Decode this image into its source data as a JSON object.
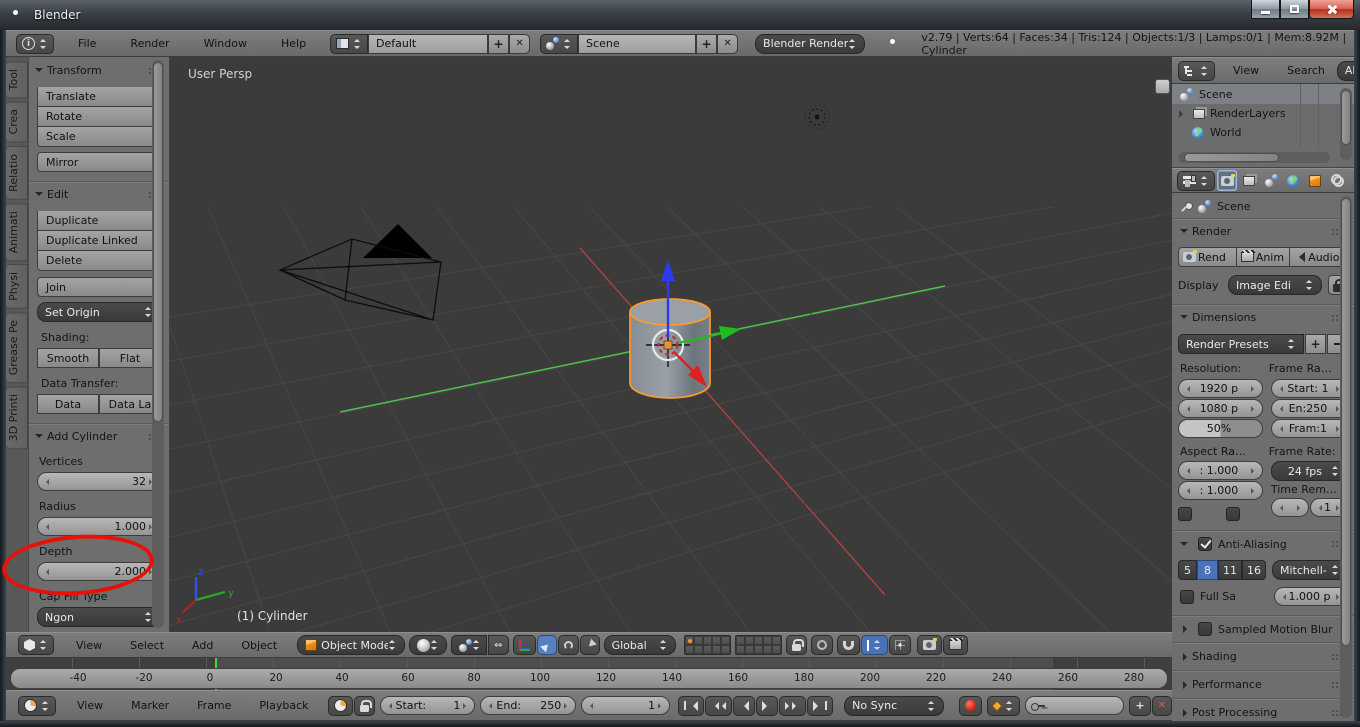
{
  "window": {
    "title": "Blender"
  },
  "topbar": {
    "menus": [
      "File",
      "Render",
      "Window",
      "Help"
    ],
    "layout_value": "Default",
    "scene_value": "Scene",
    "engine": "Blender Render",
    "stats": "v2.79 | Verts:64 | Faces:34 | Tris:124 | Objects:1/3 | Lamps:0/1 | Mem:8.92M | Cylinder"
  },
  "tool_tabs": [
    "Tool",
    "Crea",
    "Relatio",
    "Animati",
    "Physi",
    "Grease Pe",
    "3D Printi"
  ],
  "tool_shelf": {
    "transform_title": "Transform",
    "transform_buttons": [
      "Translate",
      "Rotate",
      "Scale"
    ],
    "mirror": "Mirror",
    "edit_title": "Edit",
    "edit_buttons": [
      "Duplicate",
      "Duplicate Linked",
      "Delete"
    ],
    "join": "Join",
    "set_origin": "Set Origin",
    "shading_label": "Shading:",
    "shading_buttons": [
      "Smooth",
      "Flat"
    ],
    "data_transfer_label": "Data Transfer:",
    "data_buttons": [
      "Data",
      "Data La"
    ],
    "add_cylinder_title": "Add Cylinder",
    "vertices_label": "Vertices",
    "vertices_value": "32",
    "radius_label": "Radius",
    "radius_value": "1.000",
    "depth_label": "Depth",
    "depth_value": "2.000",
    "cap_label": "Cap Fill Type",
    "cap_value": "Ngon"
  },
  "viewport": {
    "view_label": "User Persp",
    "object_label": "(1) Cylinder",
    "axis_labels": {
      "x": "x",
      "y": "y",
      "z": "z"
    }
  },
  "viewport_header": {
    "menus": [
      "View",
      "Select",
      "Add",
      "Object"
    ],
    "mode": "Object Mode",
    "orientation": "Global"
  },
  "timeline": {
    "menus": [
      "View",
      "Marker",
      "Frame",
      "Playback"
    ],
    "ticks": [
      "-40",
      "-20",
      "0",
      "20",
      "40",
      "60",
      "80",
      "100",
      "120",
      "140",
      "160",
      "180",
      "200",
      "220",
      "240",
      "260",
      "280"
    ],
    "start_label": "Start:",
    "start_value": "1",
    "end_label": "End:",
    "end_value": "250",
    "current_frame": "1",
    "sync": "No Sync"
  },
  "outliner": {
    "menus": [
      "View",
      "Search"
    ],
    "scenes_filter": "All S",
    "items": [
      "Scene",
      "RenderLayers",
      "World"
    ]
  },
  "properties": {
    "breadcrumb": "Scene",
    "render_title": "Render",
    "render_buttons": [
      "Rend",
      "Anim",
      "Audio"
    ],
    "display_label": "Display",
    "display_value": "Image Edi",
    "dimensions_title": "Dimensions",
    "presets": "Render Presets",
    "resolution_label": "Resolution:",
    "res_x": "1920 p",
    "res_y": "1080 p",
    "res_pct": "50%",
    "frame_range_label": "Frame Ra…",
    "fr_start": "Start: 1",
    "fr_end": "En:250",
    "fr_step": "Fram:1",
    "aspect_label": "Aspect Ra…",
    "aspect_x": ": 1.000",
    "aspect_y": ": 1.000",
    "framerate_label": "Frame Rate:",
    "fps": "24 fps",
    "time_label": "Time Rem…",
    "time_value": "1",
    "aa_title": "Anti-Aliasing",
    "aa_samples": [
      "5",
      "8",
      "11",
      "16"
    ],
    "aa_filter": "Mitchell-",
    "full_sample_label": "Full Sa",
    "aa_size": "1.000 p",
    "motion_blur": "Sampled Motion Blur",
    "collapsed": [
      "Shading",
      "Performance",
      "Post Processing"
    ]
  },
  "accents": {
    "selection_orange": "#ff9a2a",
    "axis_green": "#4cc34c",
    "axis_red": "#c23a3a",
    "axis_blue": "#3050f0",
    "annotation_red": "#e81109",
    "active_blue": "#4a72b8"
  },
  "icons": [
    "blender-logo",
    "info-icon",
    "layout-icon",
    "scene-balls-icon",
    "camera-icon",
    "renderlayers-icon",
    "world-globe-icon",
    "cube-icon",
    "chain-icon",
    "pin-icon",
    "lock-icon",
    "magnet-icon",
    "sphere-icon",
    "clapper-icon",
    "speaker-icon",
    "key-icon",
    "record-icon",
    "keying-diamond-icon",
    "clock-icon",
    "outliner-icon",
    "properties-icon"
  ]
}
